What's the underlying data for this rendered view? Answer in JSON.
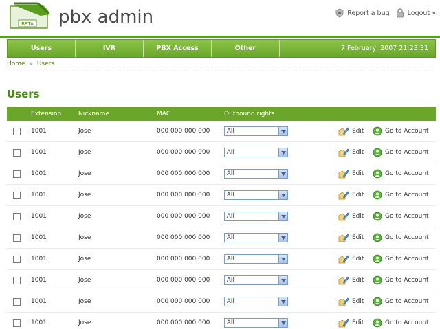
{
  "header": {
    "logo_badge": "BETA",
    "app_title": "pbx admin",
    "report_bug": "Report a bug",
    "logout": "Logout »"
  },
  "nav": {
    "items": [
      "Users",
      "IVR",
      "PBX Access",
      "Other"
    ],
    "datetime": "7 February, 2007 21:23:31"
  },
  "breadcrumb": {
    "home": "Home",
    "separator": "»",
    "current": "Users"
  },
  "section_title": "Users",
  "table": {
    "columns": [
      "Extension",
      "Nickname",
      "MAC",
      "Outbound rights"
    ],
    "edit_label": "Edit",
    "account_label": "Go to Account",
    "rows": [
      {
        "extension": "1001",
        "nickname": "Jose",
        "mac": "000 000 000 000",
        "rights": "All"
      },
      {
        "extension": "1001",
        "nickname": "Jose",
        "mac": "000 000 000 000",
        "rights": "All"
      },
      {
        "extension": "1001",
        "nickname": "Jose",
        "mac": "000 000 000 000",
        "rights": "All"
      },
      {
        "extension": "1001",
        "nickname": "Jose",
        "mac": "000 000 000 000",
        "rights": "All"
      },
      {
        "extension": "1001",
        "nickname": "Jose",
        "mac": "000 000 000 000",
        "rights": "All"
      },
      {
        "extension": "1001",
        "nickname": "Jose",
        "mac": "000 000 000 000",
        "rights": "All"
      },
      {
        "extension": "1001",
        "nickname": "Jose",
        "mac": "000 000 000 000",
        "rights": "All"
      },
      {
        "extension": "1001",
        "nickname": "Jose",
        "mac": "000 000 000 000",
        "rights": "All"
      },
      {
        "extension": "1001",
        "nickname": "Jose",
        "mac": "000 000 000 000",
        "rights": "All"
      },
      {
        "extension": "1001",
        "nickname": "Jose",
        "mac": "000 000 000 000",
        "rights": "All"
      }
    ]
  },
  "colors": {
    "accent": "#6aa629",
    "title": "#4a8e16"
  }
}
